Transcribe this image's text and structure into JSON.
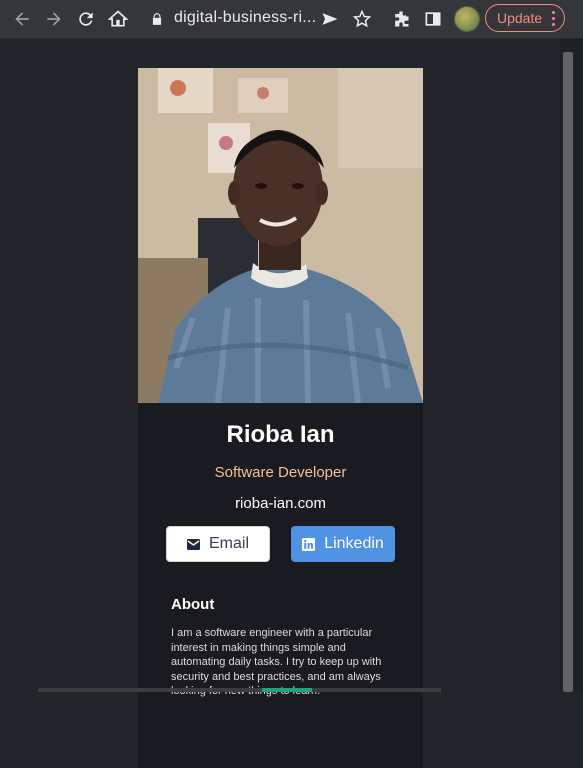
{
  "browser": {
    "url": "digital-business-ri...",
    "update_label": "Update"
  },
  "profile": {
    "name": "Rioba Ian",
    "title": "Software Developer",
    "website": "rioba-ian.com",
    "email_label": "Email",
    "linkedin_label": "Linkedin"
  },
  "about": {
    "heading": "About",
    "text": "I am a software engineer with a particular interest in making things simple and automating daily tasks. I try to keep up with security and best practices, and am always looking for new things to learn."
  },
  "colors": {
    "accent": "#f3bf99",
    "linkedin": "#5093e2",
    "update": "#f28b82"
  }
}
